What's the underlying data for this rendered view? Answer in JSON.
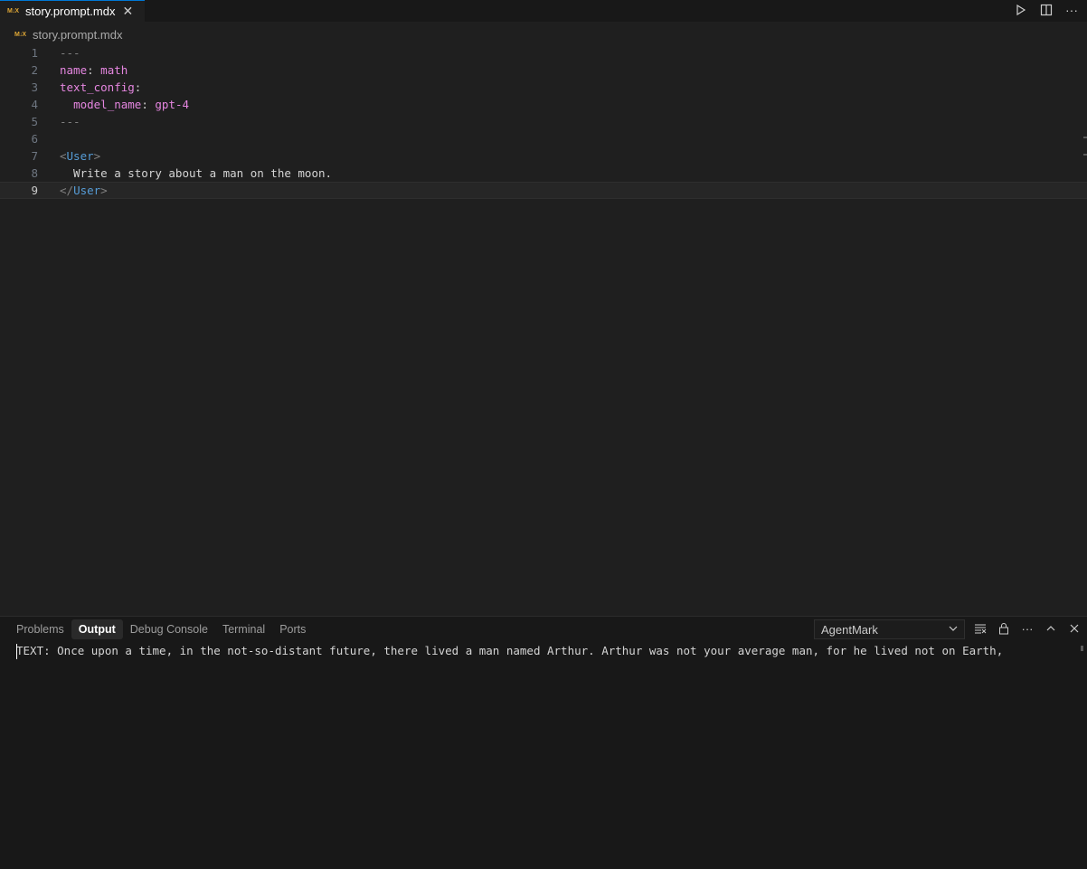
{
  "tab": {
    "icon_text": "M↓X",
    "label": "story.prompt.mdx",
    "close": "✕"
  },
  "breadcrumb": {
    "icon_text": "M↓X",
    "label": "story.prompt.mdx"
  },
  "editor_actions": {
    "run_icon": "▷",
    "split_icon": "◫",
    "more_icon": "···"
  },
  "editor": {
    "lines": [
      {
        "num": "1",
        "text": "---"
      },
      {
        "num": "2",
        "key": "name",
        "value": "math"
      },
      {
        "num": "3",
        "key": "text_config",
        "value": ""
      },
      {
        "num": "4",
        "key": "model_name",
        "value": "gpt-4"
      },
      {
        "num": "5",
        "text": "---"
      },
      {
        "num": "6",
        "text": ""
      },
      {
        "num": "7",
        "tag": "User"
      },
      {
        "num": "8",
        "text": "  Write a story about a man on the moon."
      },
      {
        "num": "9",
        "tag": "User"
      }
    ],
    "current_line": "9"
  },
  "panel": {
    "tabs": [
      "Problems",
      "Output",
      "Debug Console",
      "Terminal",
      "Ports"
    ],
    "active_tab": "Output",
    "channel": "AgentMark",
    "output_text": "TEXT: Once upon a time, in the not-so-distant future, there lived a man named Arthur. Arthur was not your average man, for he lived not on Earth,"
  }
}
